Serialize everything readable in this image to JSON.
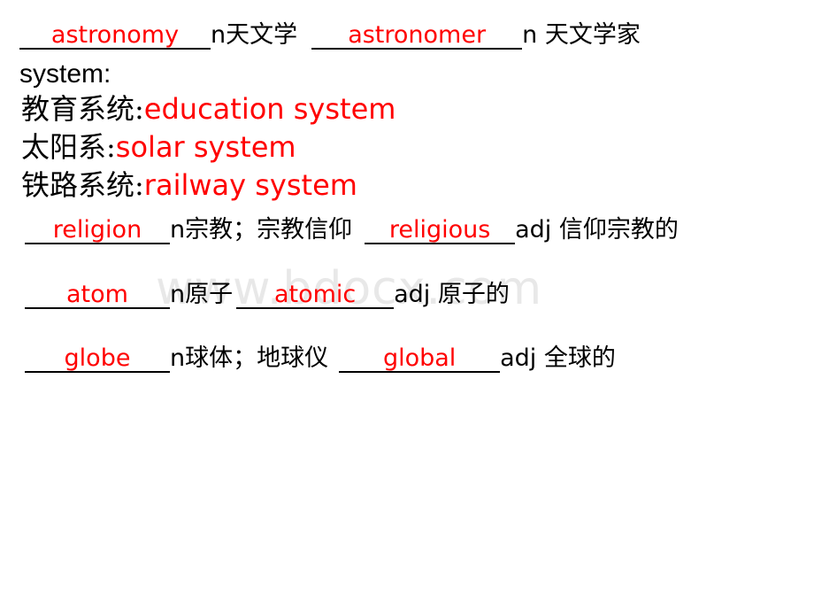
{
  "slide": {
    "background_color": "#ffffff",
    "answer_color": "#ff0000",
    "text_color": "#000000",
    "watermark": "www.bdocx.com",
    "watermark_color": "#e8e8e8"
  },
  "lines": {
    "line1": {
      "blank1_answer": "astronomy",
      "part_of_speech1": "n",
      "meaning1": "天文学",
      "blank2_answer": "astronomer",
      "part_of_speech2": "n",
      "meaning2": " 天文学家"
    },
    "line2": {
      "heading": "system:"
    },
    "line3": {
      "chinese": "教育系统:",
      "english": "education system"
    },
    "line4": {
      "chinese": "太阳系:",
      "english": "solar system"
    },
    "line5": {
      "chinese": "铁路系统:",
      "english": "railway system"
    },
    "line6": {
      "blank1_answer": "religion",
      "part_of_speech1": "n",
      "meaning1": "宗教；宗教信仰",
      "blank2_answer": "religious",
      "part_of_speech2": "adj",
      "meaning2": " 信仰宗教的"
    },
    "line7": {
      "blank1_answer": "atom",
      "part_of_speech1": "n",
      "meaning1": "原子",
      "blank2_answer": "atomic",
      "part_of_speech2": "adj",
      "meaning2": " 原子的"
    },
    "line8": {
      "blank1_answer": "globe",
      "part_of_speech1": "n",
      "meaning1": "球体；地球仪",
      "blank2_answer": "global",
      "part_of_speech2": "adj",
      "meaning2": " 全球的"
    }
  }
}
